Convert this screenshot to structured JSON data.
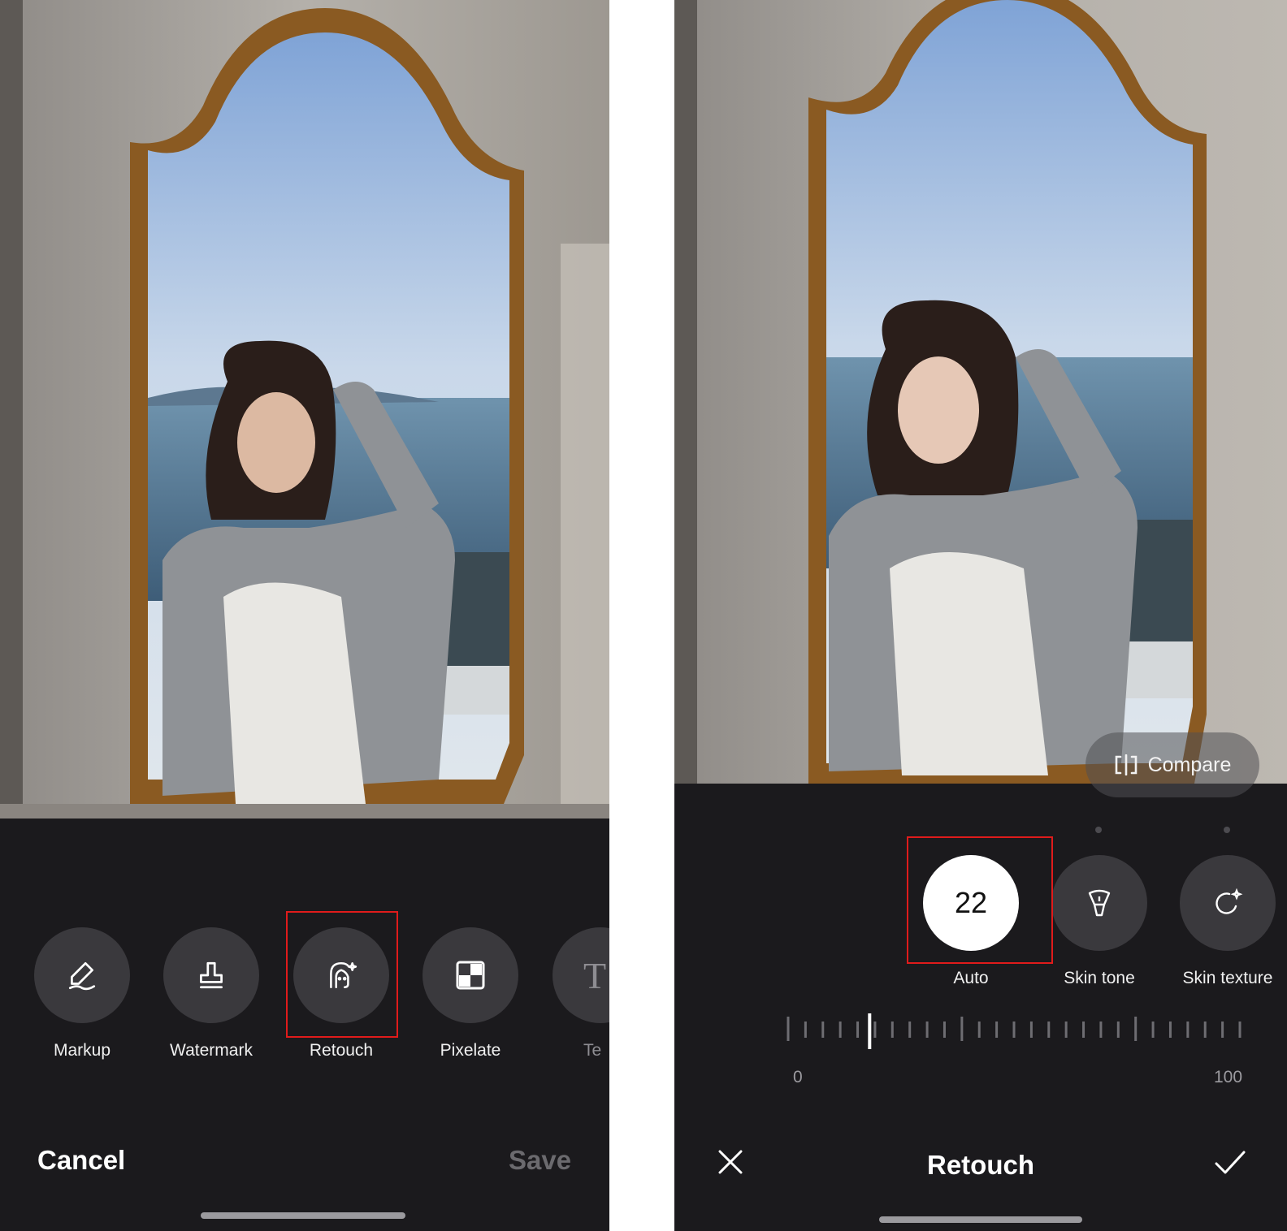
{
  "colors": {
    "background": "#1b1a1d",
    "tool_circle": "#3a393d",
    "highlight": "#e01b1b",
    "save_disabled": "#6b6a6e"
  },
  "left_screen": {
    "tools": [
      {
        "label": "Markup",
        "icon": "pen-icon"
      },
      {
        "label": "Watermark",
        "icon": "stamp-icon"
      },
      {
        "label": "Retouch",
        "icon": "retouch-face-icon",
        "highlighted": true
      },
      {
        "label": "Pixelate",
        "icon": "pixelate-icon"
      },
      {
        "label": "Te",
        "icon": "text-icon"
      }
    ],
    "cancel_label": "Cancel",
    "save_label": "Save"
  },
  "right_screen": {
    "compare_label": "Compare",
    "options": [
      {
        "label": "Auto",
        "value": "22",
        "selected": true,
        "highlighted": true
      },
      {
        "label": "Skin tone",
        "icon": "brush-icon"
      },
      {
        "label": "Skin texture",
        "icon": "sparkle-refresh-icon"
      }
    ],
    "slider": {
      "min_label": "0",
      "max_label": "100",
      "value": 22
    },
    "title": "Retouch",
    "close_icon": "close-icon",
    "confirm_icon": "check-icon"
  }
}
